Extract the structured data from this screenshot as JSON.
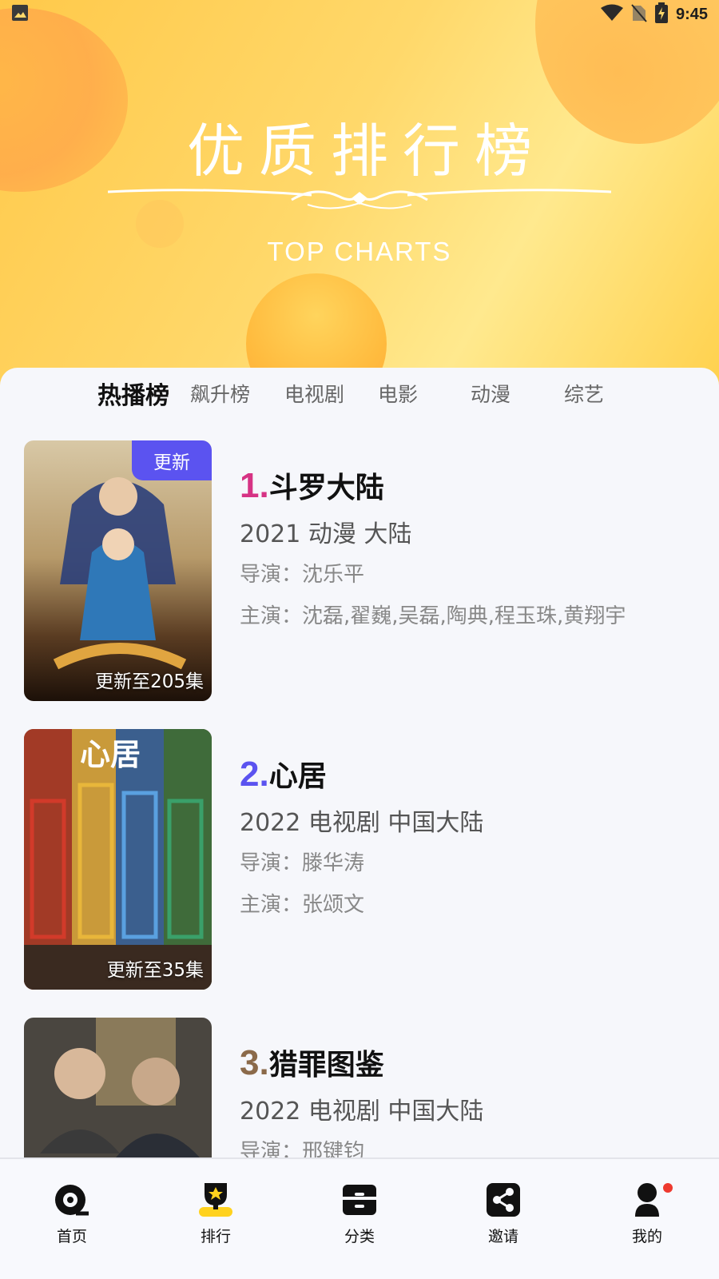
{
  "status_bar": {
    "time": "9:45",
    "icons": [
      "image-icon",
      "wifi-icon",
      "no-sim-icon",
      "battery-charging-icon"
    ]
  },
  "banner": {
    "title": "优质排行榜",
    "subtitle": "TOP CHARTS",
    "colors": {
      "bg_start": "#ffc94a",
      "bg_end": "#ffe98e"
    }
  },
  "tabs": [
    {
      "label": "热播榜",
      "active": true
    },
    {
      "label": "飙升榜",
      "active": false
    },
    {
      "label": "电视剧",
      "active": false
    },
    {
      "label": "电影",
      "active": false
    },
    {
      "label": "动漫",
      "active": false
    },
    {
      "label": "综艺",
      "active": false
    }
  ],
  "list": [
    {
      "rank": "1.",
      "rank_color": "#d63384",
      "title": "斗罗大陆",
      "meta": "2021  动漫  大陆",
      "director": "导演：沈乐平",
      "cast": "主演：沈磊,翟巍,吴磊,陶典,程玉珠,黄翔宇",
      "tag": "更新",
      "episodes": "更新至205集"
    },
    {
      "rank": "2.",
      "rank_color": "#5b53f0",
      "title": "心居",
      "meta": "2022  电视剧  中国大陆",
      "director": "导演：滕华涛",
      "cast": "主演：张颂文",
      "tag": "",
      "episodes": "更新至35集"
    },
    {
      "rank": "3.",
      "rank_color": "#8b6a4a",
      "title": "猎罪图鉴",
      "meta": "2022  电视剧  中国大陆",
      "director": "导演：邢键钧",
      "cast": "",
      "tag": "",
      "episodes": ""
    }
  ],
  "bottom_nav": [
    {
      "label": "首页",
      "icon": "home-reel-icon"
    },
    {
      "label": "排行",
      "icon": "trophy-icon",
      "active": true
    },
    {
      "label": "分类",
      "icon": "category-box-icon"
    },
    {
      "label": "邀请",
      "icon": "share-icon"
    },
    {
      "label": "我的",
      "icon": "user-icon",
      "badge": true
    }
  ]
}
